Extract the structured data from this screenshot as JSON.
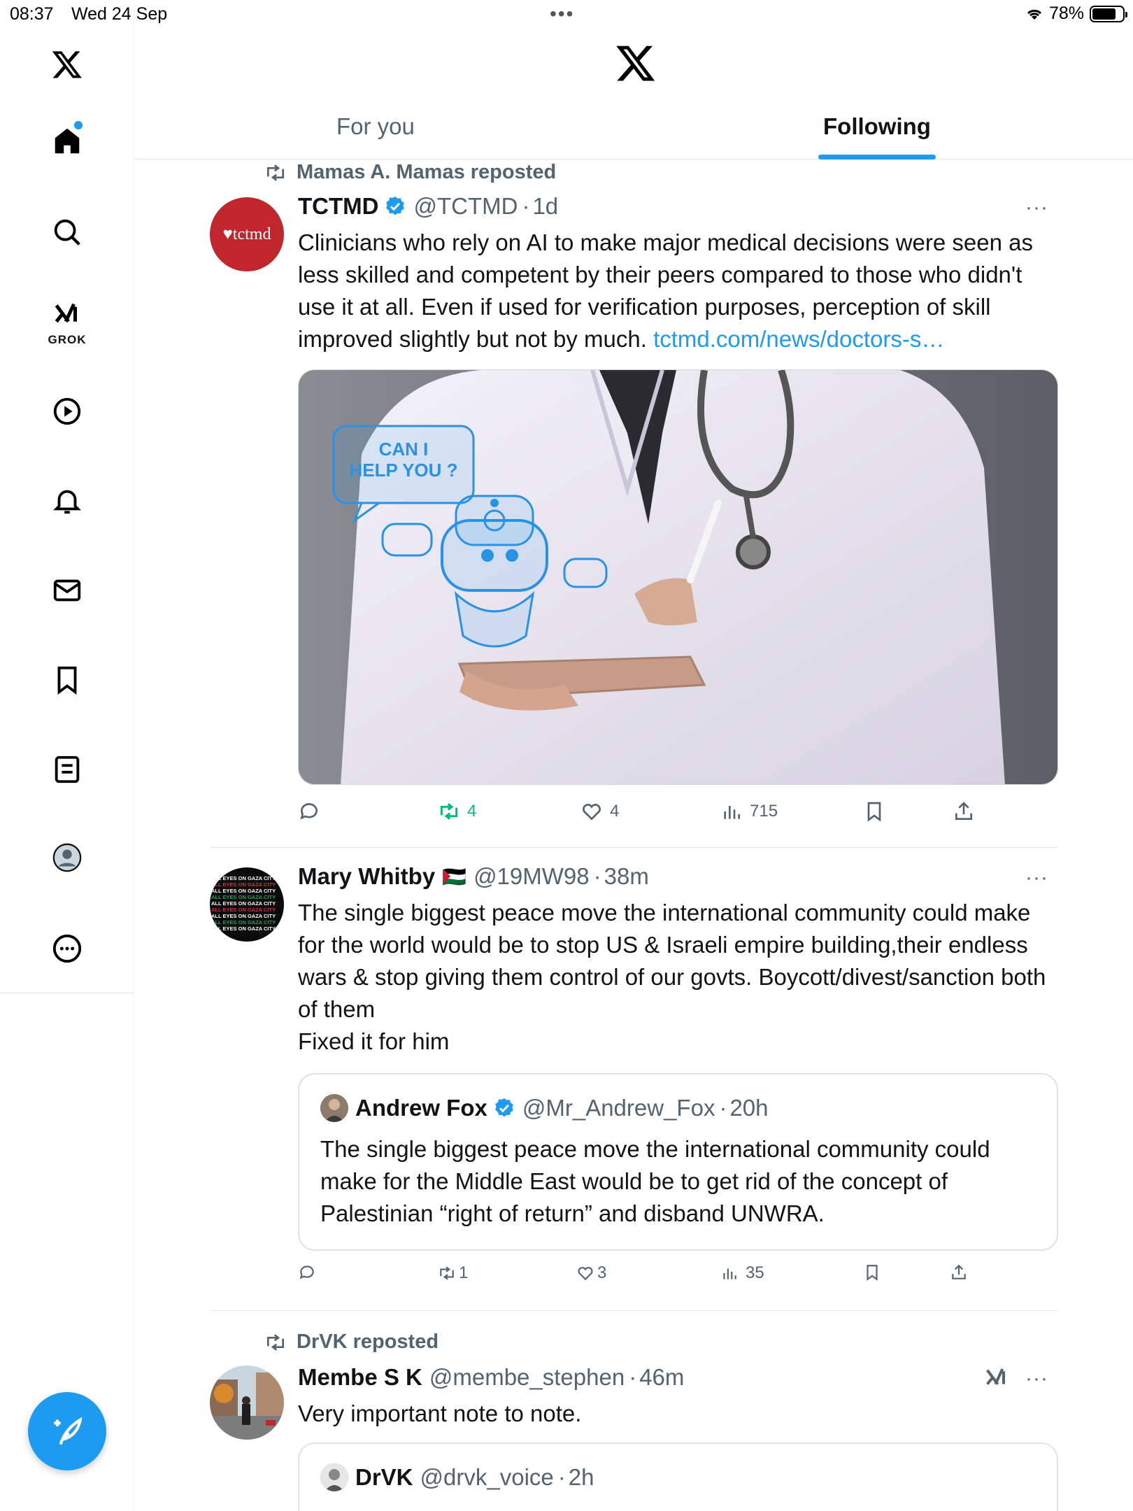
{
  "status_bar": {
    "time": "08:37",
    "date": "Wed 24 Sep",
    "battery": "78%",
    "battery_level": 0.78
  },
  "sidebar": {
    "grok_label": "GROK"
  },
  "header": {
    "tabs": [
      "For you",
      "Following"
    ],
    "active_tab": "Following"
  },
  "posts": [
    {
      "reposted_by": "Mamas A. Mamas reposted",
      "name": "TCTMD",
      "handle": "@TCTMD",
      "time": "1d",
      "avatar_text": "tctmd",
      "text": "Clinicians who rely on AI to make major medical decisions were seen as less skilled and competent by their peers compared to those who didn't use it at all. Even if used for verification purposes, perception of skill improved slightly but not by much. ",
      "link": "tctmd.com/news/doctors-s…",
      "media": {
        "bubble_text_1": "CAN I",
        "bubble_text_2": "HELP YOU ?"
      },
      "stats": {
        "replies": "",
        "reposts": "4",
        "likes": "4",
        "views": "715"
      }
    },
    {
      "name": "Mary Whitby",
      "flag": "🇵🇸",
      "handle": "@19MW98",
      "time": "38m",
      "avatar_text": "ALL EYES ON GAZA CITY",
      "text_lines": [
        "The single biggest peace move the international community could make for the world would be to stop US & Israeli empire building,their endless wars & stop giving them control of our govts. Boycott/divest/sanction both of them",
        "Fixed it for him"
      ],
      "quote": {
        "name": "Andrew Fox",
        "handle": "@Mr_Andrew_Fox",
        "time": "20h",
        "text": "The single biggest peace move the international community could make for the Middle East would be to get rid of the concept of Palestinian “right of return” and disband UNWRA."
      },
      "stats": {
        "replies": "",
        "reposts": "1",
        "likes": "3",
        "views": "35"
      }
    },
    {
      "reposted_by": "DrVK reposted",
      "name": "Membe S K",
      "handle": "@membe_stephen",
      "time": "46m",
      "text": "Very important note to note.",
      "quote": {
        "name": "DrVK",
        "handle": "@drvk_voice",
        "time": "2h"
      }
    }
  ],
  "colors": {
    "accent": "#1d9bf0",
    "repost_green": "#00ba7c",
    "secondary_text": "#536471"
  }
}
